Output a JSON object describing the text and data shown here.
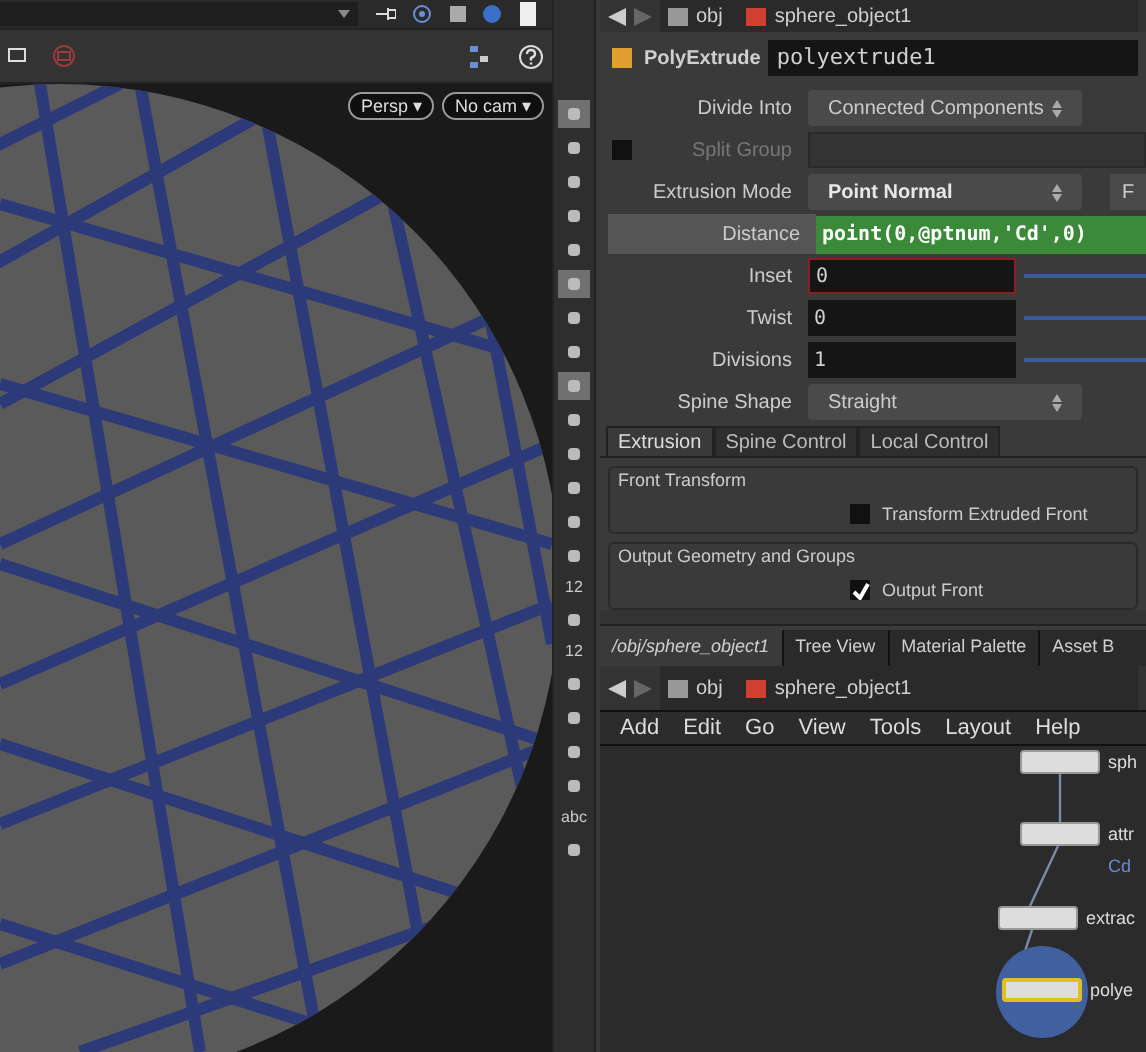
{
  "viewport": {
    "camera_menus": [
      "Persp ▾",
      "No cam ▾"
    ],
    "tool_labels": [
      "12",
      "12",
      "abc"
    ]
  },
  "parameter_pane": {
    "path": [
      "obj",
      "sphere_object1"
    ],
    "node_type": "PolyExtrude",
    "node_name": "polyextrude1",
    "parameters": [
      {
        "kind": "dropdown",
        "label": "Divide Into",
        "value": "Connected Components",
        "bold": false,
        "disabled": false
      },
      {
        "kind": "text",
        "label": "Split Group",
        "disabled": true,
        "checked": false
      },
      {
        "kind": "dropdown",
        "label": "Extrusion Mode",
        "value": "Point Normal",
        "bold": true,
        "disabled": false,
        "extra_button": "F"
      },
      {
        "kind": "expression",
        "label": "Distance",
        "value": "point(0,@ptnum,'Cd',0)",
        "disabled": false
      },
      {
        "kind": "slider",
        "label": "Inset",
        "value": "0",
        "focused": true,
        "disabled": false
      },
      {
        "kind": "slider",
        "label": "Twist",
        "value": "0",
        "focused": false,
        "disabled": false
      },
      {
        "kind": "slider",
        "label": "Divisions",
        "value": "1",
        "focused": false,
        "disabled": false
      },
      {
        "kind": "dropdown",
        "label": "Spine Shape",
        "value": "Straight",
        "bold": false,
        "disabled": false
      }
    ],
    "tabs": [
      {
        "label": "Extrusion",
        "selected": true
      },
      {
        "label": "Spine Control",
        "selected": false
      },
      {
        "label": "Local Control",
        "selected": false
      }
    ],
    "groups": [
      {
        "title": "Front Transform",
        "checkbox": {
          "label": "Transform Extruded Front",
          "checked": false
        }
      },
      {
        "title": "Output Geometry and Groups",
        "checkbox": {
          "label": "Output Front",
          "checked": true
        }
      }
    ]
  },
  "network_pane": {
    "tabs": [
      {
        "label": "/obj/sphere_object1",
        "selected": true
      },
      {
        "label": "Tree View",
        "selected": false
      },
      {
        "label": "Material Palette",
        "selected": false
      },
      {
        "label": "Asset B",
        "selected": false
      }
    ],
    "path": [
      "obj",
      "sphere_object1"
    ],
    "menu": [
      "Add",
      "Edit",
      "Go",
      "View",
      "Tools",
      "Layout",
      "Help"
    ],
    "nodes": [
      {
        "label": "sph",
        "selected": false
      },
      {
        "label": "attr",
        "sublabel": "Cd",
        "selected": false
      },
      {
        "label": "extrac",
        "selected": false
      },
      {
        "label": "polye",
        "selected": true
      }
    ]
  }
}
